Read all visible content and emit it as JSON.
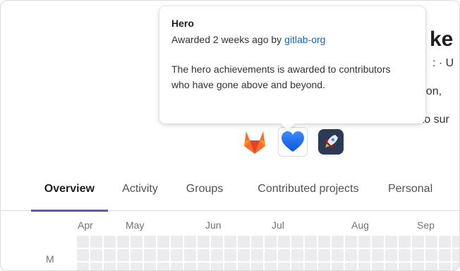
{
  "profile": {
    "name_partial": "ke E",
    "meta_partial": ": · U",
    "location_partial": "ndon,",
    "bio_partial": "i love to sur"
  },
  "tooltip": {
    "title": "Hero",
    "awarded_prefix": "Awarded 2 weeks ago by ",
    "awarded_by": "gitlab-org",
    "description": "The hero achievements is awarded to contributors who have gone above and beyond."
  },
  "achievements": [
    {
      "name": "gitlab-icon"
    },
    {
      "name": "blue-heart-icon"
    },
    {
      "name": "rocket-icon"
    }
  ],
  "tabs": [
    {
      "label": "Overview",
      "active": true
    },
    {
      "label": "Activity",
      "active": false
    },
    {
      "label": "Groups",
      "active": false
    },
    {
      "label": "Contributed projects",
      "active": false
    },
    {
      "label": "Personal",
      "active": false
    }
  ],
  "calendar": {
    "months": [
      "Apr",
      "May",
      "Jun",
      "Jul",
      "Aug",
      "Sep"
    ],
    "day_label": "M"
  },
  "colors": {
    "link": "#1068bf",
    "tab_indicator": "#6b4fbb",
    "heart": "#1a6ef5",
    "gitlab_orange": "#fc6d26",
    "rocket_bg": "#2b3a55",
    "cell_empty": "#ececef"
  }
}
